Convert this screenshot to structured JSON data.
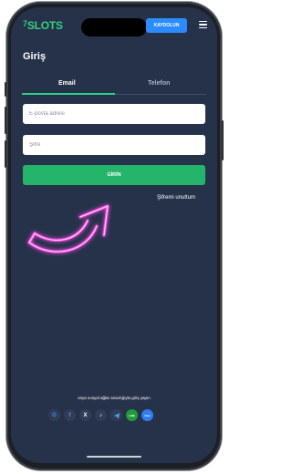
{
  "header": {
    "logo_number": "7",
    "logo_text": "SLOTS",
    "signup_label": "KAYDOLUN"
  },
  "login": {
    "title": "Giriş",
    "tabs": [
      {
        "label": "Email",
        "active": true
      },
      {
        "label": "Telefon",
        "active": false
      }
    ],
    "email_placeholder": "E-posta adresi",
    "password_placeholder": "Şifre",
    "submit_label": "GİRİN",
    "forgot_label": "Şifremi unuttum"
  },
  "social": {
    "caption": "veya sosyal ağlar aracılığıyla giriş yapın",
    "icons": [
      "google-icon",
      "facebook-icon",
      "x-icon",
      "tiktok-icon",
      "telegram-icon",
      "line-icon",
      "zalo-icon"
    ],
    "glyphs": {
      "google": "G",
      "facebook": "f",
      "x": "X",
      "tiktok": "♪",
      "line": "LINE",
      "zalo": "Zalo"
    }
  },
  "colors": {
    "accent": "#2fcf86",
    "button_blue": "#2a8cff",
    "background": "#26324a",
    "arrow": "#ff4fe8"
  }
}
